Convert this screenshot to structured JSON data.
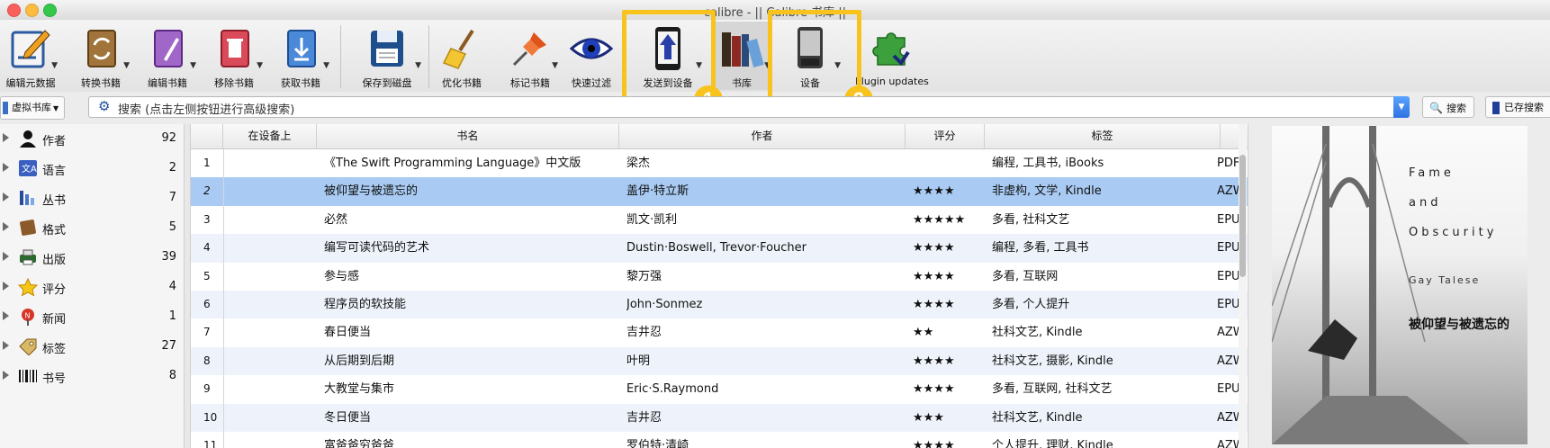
{
  "window": {
    "title": "calibre - || Calibre 书库 ||"
  },
  "toolbar": {
    "items": [
      {
        "id": "edit-metadata",
        "label": "编辑元数据",
        "has_menu": true
      },
      {
        "id": "convert",
        "label": "转换书籍",
        "has_menu": true
      },
      {
        "id": "edit-book",
        "label": "编辑书籍",
        "has_menu": true
      },
      {
        "id": "remove",
        "label": "移除书籍",
        "has_menu": true
      },
      {
        "id": "fetch",
        "label": "获取书籍",
        "has_menu": true
      },
      {
        "id": "save",
        "label": "保存到磁盘",
        "has_menu": true
      },
      {
        "id": "polish",
        "label": "优化书籍",
        "has_menu": false
      },
      {
        "id": "mark",
        "label": "标记书籍",
        "has_menu": true
      },
      {
        "id": "quickview",
        "label": "快速过滤",
        "has_menu": false
      },
      {
        "id": "send",
        "label": "发送到设备",
        "has_menu": true
      },
      {
        "id": "library",
        "label": "书库",
        "has_menu": true
      },
      {
        "id": "device",
        "label": "设备",
        "has_menu": true
      },
      {
        "id": "plugins",
        "label": "Plugin updates",
        "has_menu": false
      }
    ],
    "badge_1": "1",
    "badge_2": "2",
    "highlight_color": "#f7c31c"
  },
  "search": {
    "virtual_library": "虚拟书库",
    "placeholder": "搜索 (点击左侧按钮进行高级搜索)",
    "search_button": "搜索",
    "saved_button": "已存搜索"
  },
  "sidebar": {
    "items": [
      {
        "name": "作者",
        "count": "92",
        "icon": "person-icon"
      },
      {
        "name": "语言",
        "count": "2",
        "icon": "language-icon"
      },
      {
        "name": "丛书",
        "count": "7",
        "icon": "series-icon"
      },
      {
        "name": "格式",
        "count": "5",
        "icon": "format-book-icon"
      },
      {
        "name": "出版",
        "count": "39",
        "icon": "printer-icon"
      },
      {
        "name": "评分",
        "count": "4",
        "icon": "star-icon"
      },
      {
        "name": "新闻",
        "count": "1",
        "icon": "news-pin-icon"
      },
      {
        "name": "标签",
        "count": "27",
        "icon": "tag-icon"
      },
      {
        "name": "书号",
        "count": "8",
        "icon": "barcode-icon"
      }
    ]
  },
  "table": {
    "headers": {
      "on_device": "在设备上",
      "title": "书名",
      "author": "作者",
      "rating": "评分",
      "tags": "标签"
    },
    "rows": [
      {
        "n": "1",
        "title": "《The Swift Programming Language》中文版",
        "author": "梁杰",
        "rating": "",
        "tags": "编程, 工具书, iBooks",
        "fmt": "PDF"
      },
      {
        "n": "2",
        "title": "被仰望与被遗忘的",
        "author": "盖伊·特立斯",
        "rating": "★★★★",
        "tags": "非虚构, 文学, Kindle",
        "fmt": "AZW"
      },
      {
        "n": "3",
        "title": "必然",
        "author": "凯文·凯利",
        "rating": "★★★★★",
        "tags": "多看, 社科文艺",
        "fmt": "EPU"
      },
      {
        "n": "4",
        "title": "编写可读代码的艺术",
        "author": "Dustin·Boswell, Trevor·Foucher",
        "rating": "★★★★",
        "tags": "编程, 多看, 工具书",
        "fmt": "EPU"
      },
      {
        "n": "5",
        "title": "参与感",
        "author": "黎万强",
        "rating": "★★★★",
        "tags": "多看, 互联网",
        "fmt": "EPU"
      },
      {
        "n": "6",
        "title": "程序员的软技能",
        "author": "John·Sonmez",
        "rating": "★★★★",
        "tags": "多看, 个人提升",
        "fmt": "EPU"
      },
      {
        "n": "7",
        "title": "春日便当",
        "author": "吉井忍",
        "rating": "★★",
        "tags": "社科文艺, Kindle",
        "fmt": "AZW"
      },
      {
        "n": "8",
        "title": "从后期到后期",
        "author": "叶明",
        "rating": "★★★★",
        "tags": "社科文艺, 摄影, Kindle",
        "fmt": "AZW"
      },
      {
        "n": "9",
        "title": "大教堂与集市",
        "author": "Eric·S.Raymond",
        "rating": "★★★★",
        "tags": "多看, 互联网, 社科文艺",
        "fmt": "EPU"
      },
      {
        "n": "10",
        "title": "冬日便当",
        "author": "吉井忍",
        "rating": "★★★",
        "tags": "社科文艺, Kindle",
        "fmt": "AZW"
      },
      {
        "n": "11",
        "title": "富爸爸穷爸爸",
        "author": "罗伯特·清崎",
        "rating": "★★★★",
        "tags": "个人提升, 理财, Kindle",
        "fmt": "AZW"
      }
    ],
    "selected_index": 1
  },
  "cover": {
    "line1": "Fame",
    "line2": "and",
    "line3": "Obscurity",
    "author_en": "Gay Talese",
    "title_cn": "被仰望与被遗忘的"
  }
}
